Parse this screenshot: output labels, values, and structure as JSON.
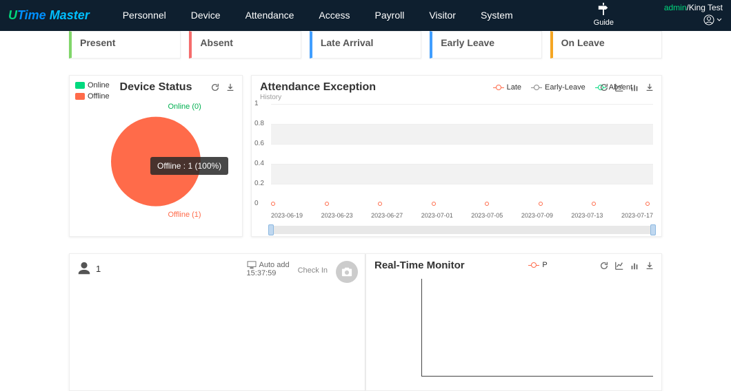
{
  "header": {
    "logo_part1": "U",
    "logo_part2": "Time",
    "logo_part3": " Master",
    "nav": [
      "Personnel",
      "Device",
      "Attendance",
      "Access",
      "Payroll",
      "Visitor",
      "System"
    ],
    "guide": "Guide",
    "user_prefix": "admin",
    "user_sep": "/",
    "user_company": "King Test"
  },
  "status_tabs": {
    "present": "Present",
    "absent": "Absent",
    "late": "Late Arrival",
    "early": "Early Leave",
    "leave": "On Leave"
  },
  "device_panel": {
    "title": "Device Status",
    "legend_online": "Online",
    "legend_offline": "Offline",
    "online_color": "#00d97e",
    "offline_color": "#ff6b4a",
    "tooltip": "Offline : 1 (100%)",
    "label_online": "Online (0)",
    "label_offline": "Offline (1)"
  },
  "attend_panel": {
    "title": "Attendance Exception",
    "history": "History",
    "legend": {
      "late": "Late",
      "early": "Early-Leave",
      "absent": "Absent"
    }
  },
  "chart_data": {
    "type": "line",
    "title": "Attendance Exception",
    "xlabel": "",
    "ylabel": "",
    "ylim": [
      0,
      1
    ],
    "y_ticks": [
      "1",
      "0.8",
      "0.6",
      "0.4",
      "0.2",
      "0"
    ],
    "categories": [
      "2023-06-19",
      "2023-06-23",
      "2023-06-27",
      "2023-07-01",
      "2023-07-05",
      "2023-07-09",
      "2023-07-13",
      "2023-07-17"
    ],
    "series": [
      {
        "name": "Late",
        "color": "#ff6b4a",
        "values": [
          0,
          0,
          0,
          0,
          0,
          0,
          0,
          0
        ]
      },
      {
        "name": "Early-Leave",
        "color": "#888888",
        "values": [
          0,
          0,
          0,
          0,
          0,
          0,
          0,
          0
        ]
      },
      {
        "name": "Absent",
        "color": "#00d97e",
        "values": [
          0,
          0,
          0,
          0,
          0,
          0,
          0,
          0
        ]
      }
    ]
  },
  "entry": {
    "user_id": "1",
    "auto_add": "Auto add",
    "time": "15:37:59",
    "type": "Check In"
  },
  "monitor": {
    "title": "Real-Time Monitor",
    "legend_p": "P"
  }
}
